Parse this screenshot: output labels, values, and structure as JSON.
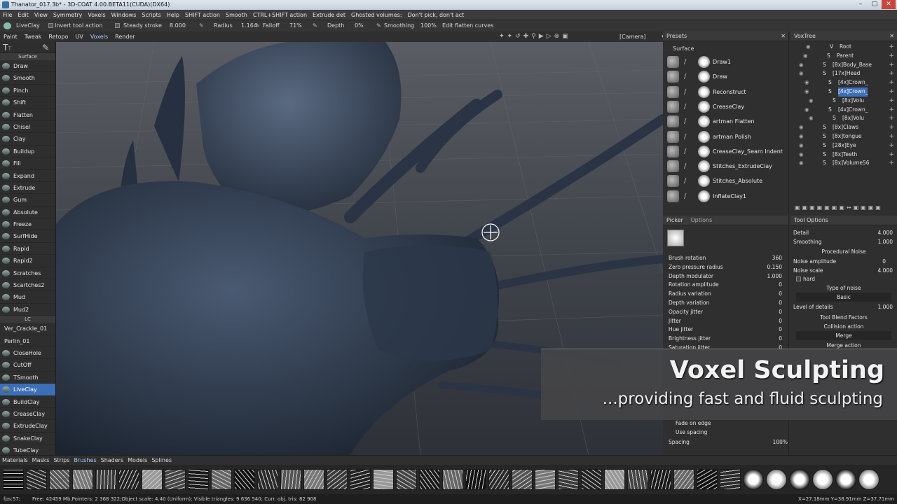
{
  "window": {
    "title": "Thanator_017.3b* - 3D-COAT 4.00.BETA11(CUDA)(DX64)"
  },
  "menu": [
    "File",
    "Edit",
    "View",
    "Symmetry",
    "Voxels",
    "Windows",
    "Scripts",
    "Help",
    "SHIFT action",
    "Smooth",
    "CTRL+SHIFT action",
    "Extrude det",
    "Ghosted volumes:",
    "Don't pick, don't act"
  ],
  "tool_options": {
    "tool_name": "LiveClay",
    "invert": "Invert tool action",
    "steady": "Steady stroke",
    "steady_val": "8.000",
    "radius": "Radius",
    "radius_val": "1.164",
    "falloff": "Falloff",
    "falloff_val": "71%",
    "depth": "Depth",
    "depth_val": "0%",
    "smoothing": "Smoothing",
    "smoothing_val": "100%",
    "edit_curves": "Edit flatten curves"
  },
  "rooms": [
    "Paint",
    "Tweak",
    "Retopo",
    "UV",
    "Voxels",
    "Render"
  ],
  "rooms_active": "Voxels",
  "camera": "[Camera]",
  "left_section": "Surface",
  "left_tools": [
    "Draw",
    "Smooth",
    "Pinch",
    "Shift",
    "Flatten",
    "Chisel",
    "Clay",
    "Buildup",
    "Fill",
    "Expand",
    "Extrude",
    "Gum",
    "Absolute",
    "Freeze",
    "SurfHide",
    "Rapid",
    "Rapid2",
    "Scratches",
    "Scartches2",
    "Mud",
    "Mud2"
  ],
  "lc_section": "LC",
  "lc_tools": [
    "Ver_Crackle_01",
    "Perlin_01",
    "CloseHole",
    "CutOff",
    "TSmooth",
    "LiveClay",
    "BuildClay",
    "CreaseClay",
    "ExtrudeClay",
    "SnakeClay",
    "TubeClay"
  ],
  "lc_active": "LiveClay",
  "presets": {
    "title": "Presets",
    "section": "Surface",
    "items": [
      "Draw1",
      "Draw",
      "Reconstruct",
      "CreaseClay",
      "artman Flatten",
      "artman Polish",
      "CreaseClay_Seam Indent",
      "Stitches_ExtrudeClay",
      "Stitches_Absolute",
      "InflateClay1"
    ]
  },
  "voxtree": {
    "title": "VoxTree",
    "items": [
      "Root",
      "Parent",
      "[8x]Body_Base",
      "[17x]Head",
      "[4x]Crown_",
      "[4x]Crown_",
      "[8x]Volu",
      "[4x]Crown_",
      "[8x]Volu",
      "[8x]Claws",
      "[8x]tongue",
      "[28x]Eye",
      "[8x]Teeth",
      "[8x]Volume56"
    ]
  },
  "picker": {
    "tabs": [
      "Picker",
      "Options"
    ],
    "rows": [
      {
        "label": "Brush rotation",
        "value": "360"
      },
      {
        "label": "Zero pressure radius",
        "value": "0.150"
      },
      {
        "label": "Depth modulator",
        "value": "1.000"
      },
      {
        "label": "Rotation amplitude",
        "value": "0"
      },
      {
        "label": "Radius variation",
        "value": "0"
      },
      {
        "label": "Depth variation",
        "value": "0"
      },
      {
        "label": "Opacity jitter",
        "value": "0"
      },
      {
        "label": "Jitter",
        "value": "0"
      },
      {
        "label": "Hue jitter",
        "value": "0"
      },
      {
        "label": "Brightness jitter",
        "value": "0"
      },
      {
        "label": "Saturation jitter",
        "value": "0"
      }
    ],
    "fade_on_edge": "Fade on edge",
    "use_spacing": "Use spacing",
    "spacing": "Spacing",
    "spacing_val": "100%"
  },
  "tool_panel": {
    "title": "Tool Options",
    "detail": "Detail",
    "detail_val": "4.000",
    "smoothing": "Smoothing",
    "smoothing_val": "1.000",
    "proc_noise": "Procedural Noise",
    "noise_amp": "Noise amplitude",
    "noise_amp_val": "0",
    "noise_scale": "Noise scale",
    "noise_scale_val": "4.000",
    "hard": "hard",
    "type_noise": "Type of noise",
    "type_noise_val": "Basic",
    "level_details": "Level of details",
    "level_details_val": "1.000",
    "blend": "Tool Blend Factors",
    "collision": "Collision action",
    "collision_val": "Merge",
    "merge_action": "Merge action"
  },
  "bottom_tabs": [
    "Materials",
    "Masks",
    "Strips",
    "Brushes",
    "Shaders",
    "Models",
    "Splines"
  ],
  "bottom_active": "Brushes",
  "status": {
    "fps": "fps:57;",
    "info": "Free: 42459 Mb,Pointers: 2 368 322;Object scale: 4.40 (Uniform); Visible triangles: 9 636 540; Curr. obj. tris: 82 908",
    "coords": "X=27.18mm Y=38.91mm Z=37.71mm"
  },
  "overlay": {
    "title": "Voxel Sculpting",
    "subtitle": "...providing fast and fluid sculpting"
  },
  "colors": {
    "accent": "#3d6fb8",
    "sculpt": "#2f3a4c",
    "bg": "#2b2b2b"
  }
}
